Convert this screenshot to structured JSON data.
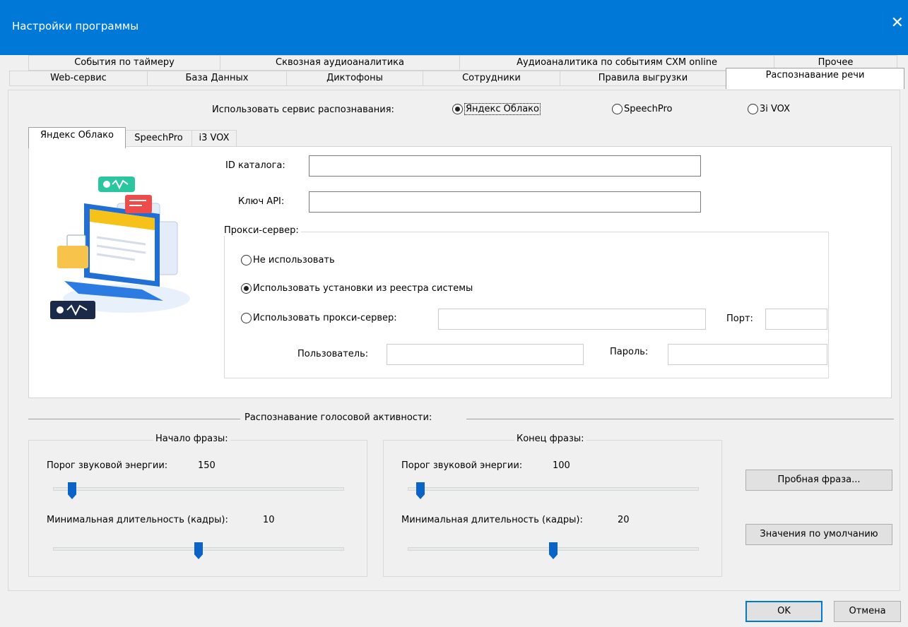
{
  "window": {
    "title": "Настройки программы",
    "close_glyph": "✕"
  },
  "tabs_row1": [
    {
      "label": "События по таймеру"
    },
    {
      "label": "Сквозная аудиоаналитика"
    },
    {
      "label": "Аудиоаналитика по событиям CXM online"
    },
    {
      "label": "Прочее"
    }
  ],
  "tabs_row2": [
    {
      "label": "Web-сервис"
    },
    {
      "label": "База Данных"
    },
    {
      "label": "Диктофоны"
    },
    {
      "label": "Сотрудники"
    },
    {
      "label": "Правила выгрузки"
    },
    {
      "label": "Распознавание речи",
      "active": true
    }
  ],
  "service": {
    "label": "Использовать сервис распознавания:",
    "options": [
      {
        "label": "Яндекс Облако",
        "checked": true
      },
      {
        "label": "SpeechPro",
        "checked": false
      },
      {
        "label": "3i VOX",
        "checked": false
      }
    ]
  },
  "subtabs": [
    {
      "label": "Яндекс Облако",
      "active": true
    },
    {
      "label": "SpeechPro"
    },
    {
      "label": "i3 VOX"
    }
  ],
  "yandex": {
    "catalog_id_label": "ID каталога:",
    "catalog_id_value": "",
    "api_key_label": "Ключ API:",
    "api_key_value": "",
    "proxy": {
      "group_label": "Прокси-сервер:",
      "opt_none": "Не использовать",
      "opt_system": "Использовать установки из реестра системы",
      "opt_custom": "Использовать прокси-сервер:",
      "selected": "opt_system",
      "proxy_value": "",
      "port_label": "Порт:",
      "port_value": "",
      "user_label": "Пользователь:",
      "user_value": "",
      "password_label": "Пароль:",
      "password_value": ""
    }
  },
  "vad": {
    "section_label": "Распознавание голосовой активности:",
    "start": {
      "group_label": "Начало фразы:",
      "energy_label": "Порог звуковой энергии:",
      "energy_value": "150",
      "duration_label": "Минимальная длительность (кадры):",
      "duration_value": "10"
    },
    "end": {
      "group_label": "Конец фразы:",
      "energy_label": "Порог звуковой энергии:",
      "energy_value": "100",
      "duration_label": "Минимальная длительность (кадры):",
      "duration_value": "20"
    },
    "test_button": "Пробная фраза...",
    "defaults_button": "Значения по умолчанию"
  },
  "footer": {
    "ok": "OK",
    "cancel": "Отмена"
  },
  "colors": {
    "titlebar": "#0078d7",
    "accent": "#0a64c8"
  }
}
